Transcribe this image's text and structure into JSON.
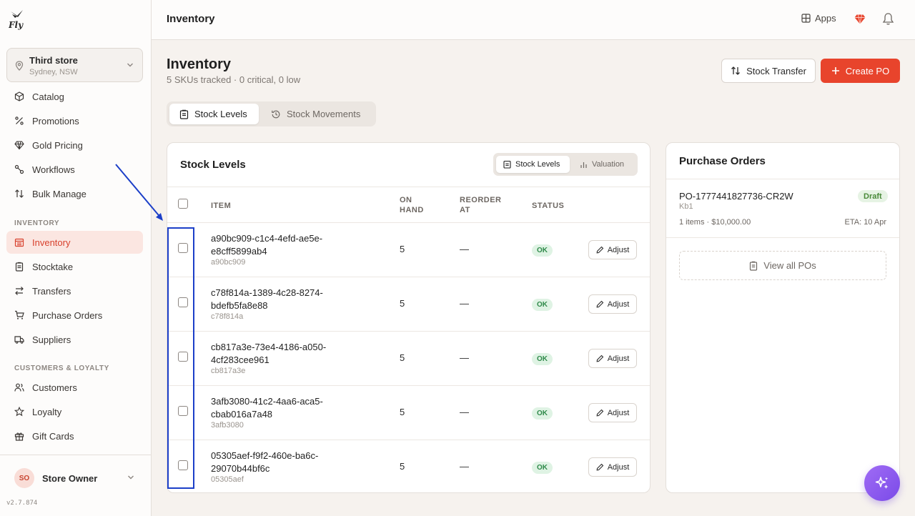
{
  "app": {
    "version": "v2.7.874"
  },
  "store": {
    "name": "Third store",
    "location": "Sydney, NSW"
  },
  "sidebar": {
    "items_top": [
      {
        "label": "Catalog",
        "icon": "box-icon"
      },
      {
        "label": "Promotions",
        "icon": "percent-icon"
      },
      {
        "label": "Gold Pricing",
        "icon": "gem-icon"
      },
      {
        "label": "Workflows",
        "icon": "workflow-icon"
      },
      {
        "label": "Bulk Manage",
        "icon": "sort-icon"
      }
    ],
    "section_inventory": "INVENTORY",
    "items_inventory": [
      {
        "label": "Inventory",
        "icon": "warehouse-icon",
        "active": true
      },
      {
        "label": "Stocktake",
        "icon": "clipboard-icon"
      },
      {
        "label": "Transfers",
        "icon": "transfer-icon"
      },
      {
        "label": "Purchase Orders",
        "icon": "cart-icon"
      },
      {
        "label": "Suppliers",
        "icon": "truck-icon"
      }
    ],
    "section_customers": "CUSTOMERS & LOYALTY",
    "items_customers": [
      {
        "label": "Customers",
        "icon": "users-icon"
      },
      {
        "label": "Loyalty",
        "icon": "star-icon"
      },
      {
        "label": "Gift Cards",
        "icon": "gift-icon"
      }
    ]
  },
  "user": {
    "initials": "SO",
    "name": "Store Owner"
  },
  "topbar": {
    "title": "Inventory",
    "apps_label": "Apps"
  },
  "page": {
    "title": "Inventory",
    "subtitle": "5 SKUs tracked · 0 critical, 0 low",
    "stock_transfer_label": "Stock Transfer",
    "create_po_label": "Create PO"
  },
  "tabs": [
    {
      "label": "Stock Levels",
      "active": true
    },
    {
      "label": "Stock Movements",
      "active": false
    }
  ],
  "stock_card": {
    "title": "Stock Levels",
    "segments": [
      {
        "label": "Stock Levels",
        "active": true
      },
      {
        "label": "Valuation",
        "active": false
      }
    ],
    "columns": {
      "item": "ITEM",
      "on_hand_1": "ON",
      "on_hand_2": "HAND",
      "reorder_1": "REORDER",
      "reorder_2": "AT",
      "status": "STATUS"
    },
    "adjust_label": "Adjust",
    "rows": [
      {
        "name_1": "a90bc909-c1c4-4efd-ae5e-",
        "name_2": "e8cff5899ab4",
        "sku": "a90bc909",
        "on_hand": "5",
        "reorder": "—",
        "status": "OK"
      },
      {
        "name_1": "c78f814a-1389-4c28-8274-",
        "name_2": "bdefb5fa8e88",
        "sku": "c78f814a",
        "on_hand": "5",
        "reorder": "—",
        "status": "OK"
      },
      {
        "name_1": "cb817a3e-73e4-4186-a050-",
        "name_2": "4cf283cee961",
        "sku": "cb817a3e",
        "on_hand": "5",
        "reorder": "—",
        "status": "OK"
      },
      {
        "name_1": "3afb3080-41c2-4aa6-aca5-",
        "name_2": "cbab016a7a48",
        "sku": "3afb3080",
        "on_hand": "5",
        "reorder": "—",
        "status": "OK"
      },
      {
        "name_1": "05305aef-f9f2-460e-ba6c-",
        "name_2": "29070b44bf6c",
        "sku": "05305aef",
        "on_hand": "5",
        "reorder": "—",
        "status": "OK"
      }
    ]
  },
  "po_card": {
    "title": "Purchase Orders",
    "order": {
      "id": "PO-1777441827736-CR2W",
      "status": "Draft",
      "vendor": "Kb1",
      "meta": "1 items · $10,000.00",
      "eta": "ETA: 10 Apr"
    },
    "view_all_label": "View all POs"
  },
  "colors": {
    "accent": "#e8442c",
    "active_nav_bg": "#fbe6e1",
    "ok_badge": "#dff3e4",
    "annotation": "#1c3fc8",
    "fab": "#8b5cf6"
  }
}
